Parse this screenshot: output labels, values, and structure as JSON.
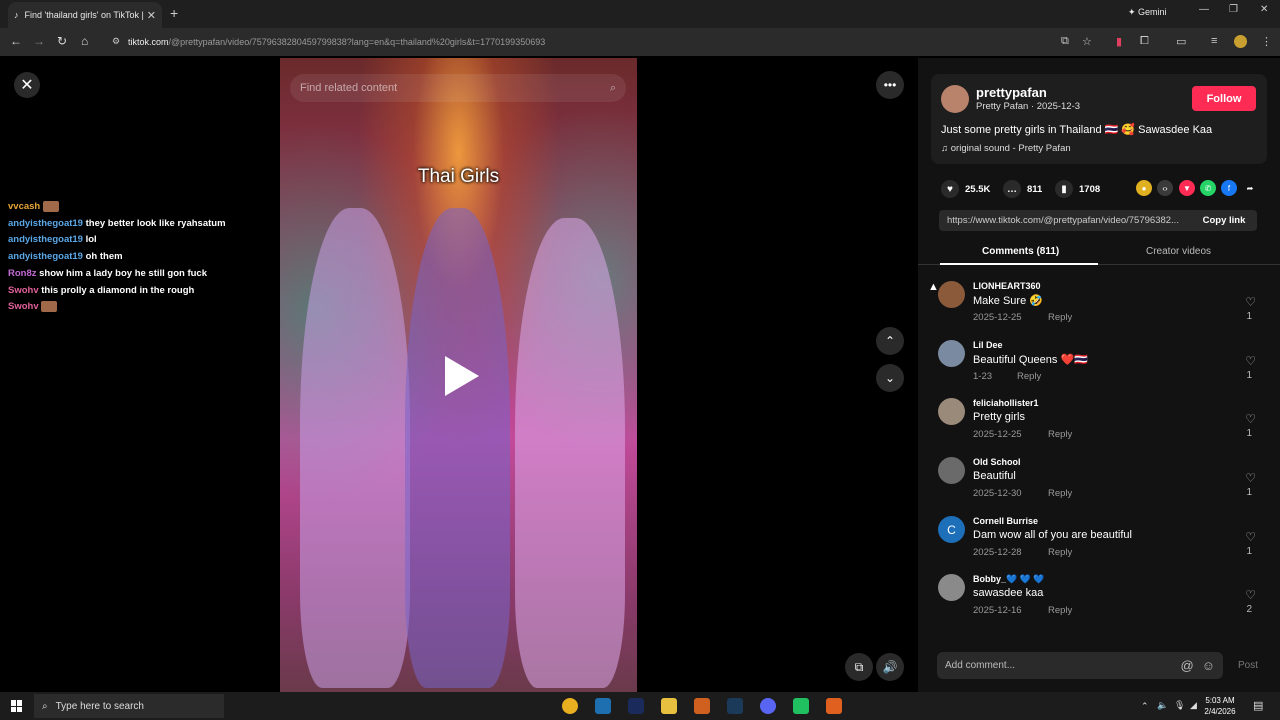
{
  "browser": {
    "tab_title": "Find 'thailand girls' on TikTok |",
    "url_host": "tiktok.com",
    "url_path": "/@prettypafan/video/7579638280459799838?lang=en&q=thailand%20girls&t=1770199350693",
    "gemini_label": "Gemini"
  },
  "chat": [
    {
      "user": "vvcash",
      "color": "#e8a53a",
      "text": "",
      "emote": true
    },
    {
      "user": "andyisthegoat19",
      "color": "#5aa7e8",
      "text": "they better look like ryahsatum",
      "emote": false
    },
    {
      "user": "andyisthegoat19",
      "color": "#5aa7e8",
      "text": "lol",
      "emote": false
    },
    {
      "user": "andyisthegoat19",
      "color": "#5aa7e8",
      "text": "oh them",
      "emote": false
    },
    {
      "user": "Ron8z",
      "color": "#c46ad6",
      "text": "show him a lady boy he still gon fuck",
      "emote": false
    },
    {
      "user": "Swohv",
      "color": "#e0609a",
      "text": "this prolly a diamond in the rough",
      "emote": false
    },
    {
      "user": "Swohv",
      "color": "#e0609a",
      "text": "",
      "emote": true
    }
  ],
  "video": {
    "search_placeholder": "Find related content",
    "overlay_title": "Thai Girls"
  },
  "author": {
    "username": "prettypafan",
    "subline": "Pretty Pafan · 2025-12-3",
    "follow_label": "Follow",
    "caption": "Just some pretty girls in Thailand 🇹🇭 🥰 Sawasdee Kaa",
    "sound": "♫  original sound - Pretty Pafan"
  },
  "stats": {
    "likes": "25.5K",
    "comments": "811",
    "saves": "1708"
  },
  "link": {
    "url": "https://www.tiktok.com/@prettypafan/video/75796382...",
    "copy_label": "Copy link"
  },
  "tabs": {
    "comments": "Comments (811)",
    "creator": "Creator videos"
  },
  "comments": [
    {
      "name": "LIONHEART360",
      "text": "Make Sure 🤣",
      "date": "2025-12-25",
      "reply": "Reply",
      "likes": "1",
      "avatar_color": "#8a5a3a"
    },
    {
      "name": "Lil Dee",
      "text": "Beautiful Queens ❤️🇹🇭",
      "date": "1-23",
      "reply": "Reply",
      "likes": "1",
      "avatar_color": "#7a8aa0"
    },
    {
      "name": "feliciahollister1",
      "text": "Pretty girls",
      "date": "2025-12-25",
      "reply": "Reply",
      "likes": "1",
      "avatar_color": "#9a8a7a"
    },
    {
      "name": "Old School",
      "text": "Beautiful",
      "date": "2025-12-30",
      "reply": "Reply",
      "likes": "1",
      "avatar_color": "#6a6a6a"
    },
    {
      "name": "Cornell Burrise",
      "text": "Dam wow all of you are beautiful",
      "date": "2025-12-28",
      "reply": "Reply",
      "likes": "1",
      "avatar_color": "#1c6fb8"
    },
    {
      "name": "Bobby_💙 💙 💙",
      "text": "sawasdee kaa",
      "date": "2025-12-16",
      "reply": "Reply",
      "likes": "2",
      "avatar_color": "#8a8a8a"
    }
  ],
  "add_comment": {
    "placeholder": "Add comment...",
    "post_label": "Post"
  },
  "taskbar": {
    "search_placeholder": "Type here to search",
    "time": "5:03 AM",
    "date": "2/4/2026"
  }
}
